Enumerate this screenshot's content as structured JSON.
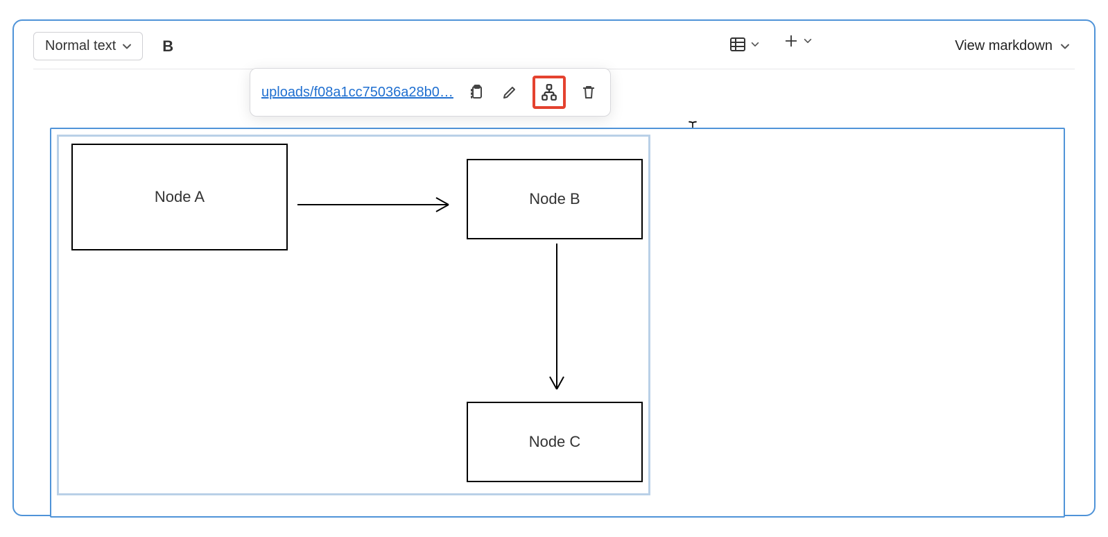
{
  "toolbar": {
    "format_label": "Normal text",
    "bold_label": "B",
    "view_markdown_label": "View markdown"
  },
  "popover": {
    "filename": "uploads/f08a1cc75036a28b0…",
    "icons": {
      "clipboard": "clipboard",
      "pencil": "pencil",
      "hierarchy": "hierarchy",
      "trash": "trash"
    }
  },
  "diagram": {
    "nodes": {
      "a": "Node A",
      "b": "Node B",
      "c": "Node C"
    }
  }
}
